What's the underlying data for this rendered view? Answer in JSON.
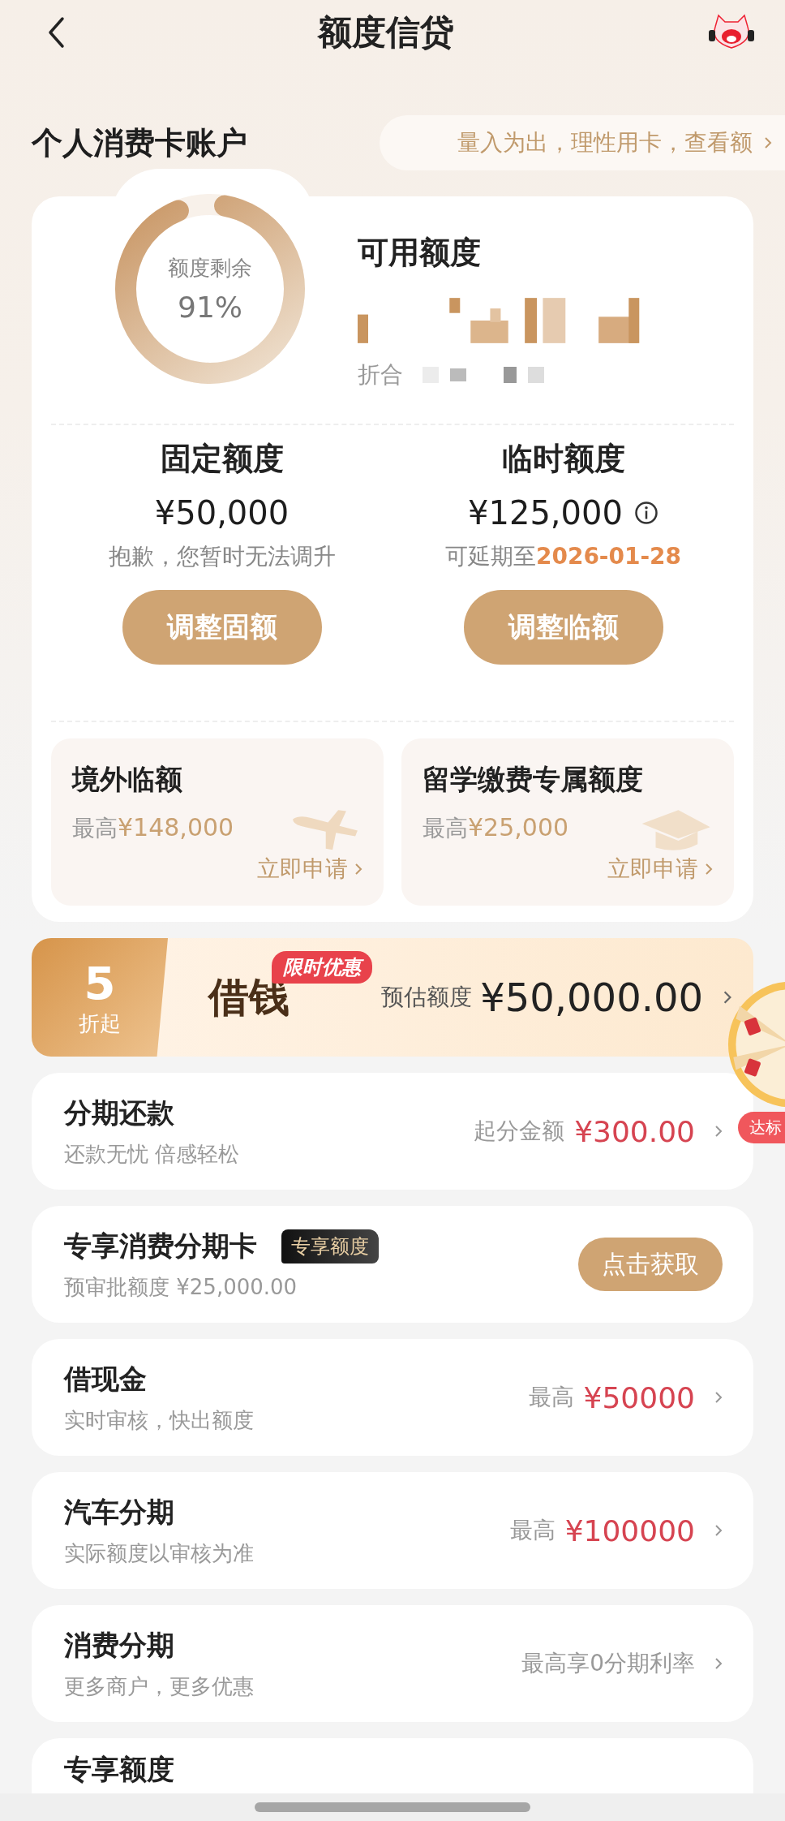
{
  "header": {
    "title": "额度信贷"
  },
  "account": {
    "title": "个人消费卡账户",
    "notice": "量入为出，理性用卡，查看额"
  },
  "summary": {
    "ring_label": "额度剩余",
    "ring_value": "91%",
    "level": 0.91,
    "available_label": "可用额度",
    "converted_label": "折合"
  },
  "limits": [
    {
      "title": "固定额度",
      "amount": "¥50,000",
      "info": false,
      "note": "抱歉，您暂时无法调升",
      "button": "调整固额"
    },
    {
      "title": "临时额度",
      "amount": "¥125,000",
      "info": true,
      "note": "可延期至",
      "note_highlight": "2026-01-28",
      "button": "调整临额"
    }
  ],
  "offers": [
    {
      "title": "境外临额",
      "prefix": "最高",
      "amount": "¥148,000",
      "link": "立即申请",
      "kind": "plane"
    },
    {
      "title": "留学缴费专属额度",
      "prefix": "最高",
      "amount": "¥25,000",
      "link": "立即申请",
      "kind": "cap"
    }
  ],
  "loan_banner": {
    "discount": "5",
    "discount_unit": "折起",
    "title": "借钱",
    "tag": "限时优惠",
    "estimate_label": "预估额度",
    "estimate": "¥50,000.00"
  },
  "float_badge": "达标",
  "products": [
    {
      "kind": "value",
      "title": "分期还款",
      "subtitle": "还款无忧 倍感轻松",
      "label": "起分金额",
      "value": "¥300.00"
    },
    {
      "kind": "button",
      "title": "专享消费分期卡",
      "badge": "专享额度",
      "subtitle": "预审批额度 ¥25,000.00",
      "button": "点击获取"
    },
    {
      "kind": "value",
      "title": "借现金",
      "subtitle": "实时审核，快出额度",
      "label": "最高",
      "value": "¥50000"
    },
    {
      "kind": "value",
      "title": "汽车分期",
      "subtitle": "实际额度以审核为准",
      "label": "最高",
      "value": "¥100000"
    },
    {
      "kind": "text",
      "title": "消费分期",
      "subtitle": "更多商户，更多优惠",
      "label": "最高享0分期利率"
    },
    {
      "kind": "cut",
      "title": "专享额度"
    }
  ]
}
